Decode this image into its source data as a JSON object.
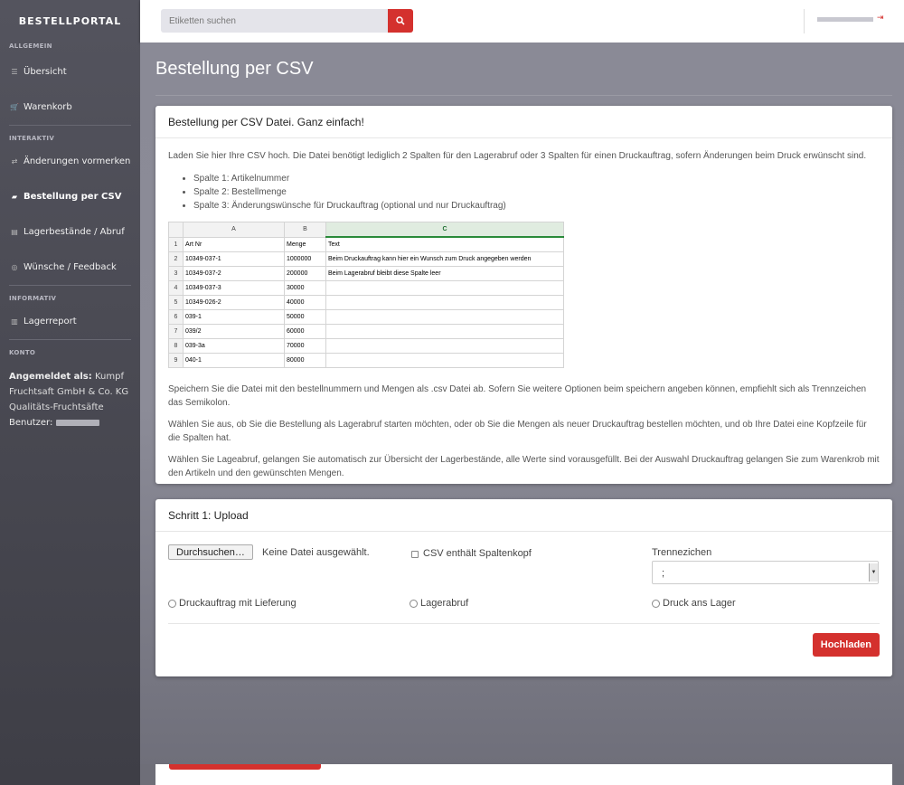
{
  "brand": "BESTELLPORTAL",
  "sidebar": {
    "sections": [
      {
        "label": "ALLGEMEIN",
        "items": [
          {
            "label": "Übersicht",
            "icon": "list-icon"
          },
          {
            "label": "Warenkorb",
            "icon": "cart-icon"
          }
        ]
      },
      {
        "label": "INTERAKTIV",
        "items": [
          {
            "label": "Änderungen vormerken",
            "icon": "exchange-icon"
          },
          {
            "label": "Bestellung per CSV",
            "icon": "folder-icon",
            "active": true
          },
          {
            "label": "Lagerbestände / Abruf",
            "icon": "archive-icon"
          },
          {
            "label": "Wünsche / Feedback",
            "icon": "globe-icon"
          }
        ]
      },
      {
        "label": "INFORMATIV",
        "items": [
          {
            "label": "Lagerreport",
            "icon": "chart-icon"
          }
        ]
      },
      {
        "label": "KONTO",
        "items": []
      }
    ],
    "account": {
      "logged_in_label": "Angemeldet als:",
      "company": "Kumpf Fruchtsaft GmbH & Co. KG Qualitäts-Fruchtsäfte",
      "user_label": "Benutzer:"
    }
  },
  "search": {
    "placeholder": "Etiketten suchen"
  },
  "page_title": "Bestellung per CSV",
  "info_panel": {
    "title": "Bestellung per CSV Datei. Ganz einfach!",
    "intro": "Laden Sie hier Ihre CSV hoch. Die Datei benötigt lediglich 2 Spalten für den Lagerabruf oder 3 Spalten für einen Druckauftrag, sofern Änderungen beim Druck erwünscht sind.",
    "bullets": [
      "Spalte 1: Artikelnummer",
      "Spalte 2: Bestellmenge",
      "Spalte 3: Änderungswünsche für Druckauftrag (optional und nur Druckauftrag)"
    ],
    "sheet": {
      "columns": [
        "A",
        "B",
        "C"
      ],
      "rows": [
        [
          "1",
          "Art Nr",
          "Menge",
          "Text"
        ],
        [
          "2",
          "10349-037-1",
          "1000000",
          "Beim Druckauftrag kann hier ein Wunsch zum Druck angegeben werden"
        ],
        [
          "3",
          "10349-037-2",
          "200000",
          "Beim Lagerabruf bleibt diese Spalte leer"
        ],
        [
          "4",
          "10349-037-3",
          "30000",
          ""
        ],
        [
          "5",
          "10349-026-2",
          "40000",
          ""
        ],
        [
          "6",
          "039-1",
          "50000",
          ""
        ],
        [
          "7",
          "039/2",
          "60000",
          ""
        ],
        [
          "8",
          "039-3a",
          "70000",
          ""
        ],
        [
          "9",
          "040-1",
          "80000",
          ""
        ]
      ]
    },
    "para2": "Speichern Sie die Datei mit den bestellnummern und Mengen als .csv Datei ab. Sofern Sie weitere Optionen beim speichern angeben können, empfiehlt sich als Trennzeichen das Semikolon.",
    "para3": "Wählen Sie aus, ob Sie die Bestellung als Lagerabruf starten möchten, oder ob Sie die Mengen als neuer Druckauftrag bestellen möchten, und ob Ihre Datei eine Kopfzeile für die Spalten hat.",
    "para4": "Wählen Sie Lageabruf, gelangen Sie automatisch zur Übersicht der Lagerbestände, alle Werte sind vorausgefüllt. Bei der Auswahl Druckauftrag gelangen Sie zum Warenkrob mit den Artikeln und den gewünschten Mengen."
  },
  "upload_panel": {
    "title": "Schritt 1: Upload",
    "browse_label": "Durchsuchen…",
    "no_file": "Keine Datei ausgewählt.",
    "header_checkbox": "CSV enthält Spaltenkopf",
    "separator_label": "Trennezichen",
    "separator_value": ";",
    "radios": [
      "Druckauftrag mit Lieferung",
      "Lagerabruf",
      "Druck ans Lager"
    ],
    "submit_label": "Hochladen"
  },
  "colors": {
    "accent": "#d4312e",
    "sidebar": "#4a4a54"
  }
}
